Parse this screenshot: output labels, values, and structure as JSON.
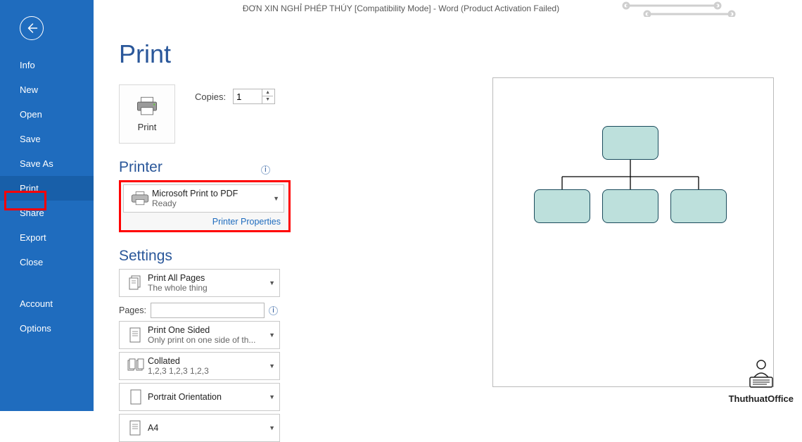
{
  "window_title": "ĐƠN XIN NGHỈ PHÉP THÚY [Compatibility Mode] - Word (Product Activation Failed)",
  "sidebar": {
    "items": [
      "Info",
      "New",
      "Open",
      "Save",
      "Save As",
      "Print",
      "Share",
      "Export",
      "Close"
    ],
    "bottom_items": [
      "Account",
      "Options"
    ],
    "selected": "Print"
  },
  "page": {
    "title": "Print",
    "print_button": "Print",
    "copies_label": "Copies:",
    "copies_value": "1"
  },
  "printer": {
    "heading": "Printer",
    "name": "Microsoft Print to PDF",
    "status": "Ready",
    "properties_link": "Printer Properties"
  },
  "settings": {
    "heading": "Settings",
    "pages_label": "Pages:",
    "pages_value": "",
    "options": [
      {
        "title": "Print All Pages",
        "sub": "The whole thing"
      },
      {
        "title": "Print One Sided",
        "sub": "Only print on one side of th..."
      },
      {
        "title": "Collated",
        "sub": "1,2,3   1,2,3   1,2,3"
      },
      {
        "title": "Portrait Orientation",
        "sub": ""
      },
      {
        "title": "A4",
        "sub": ""
      }
    ]
  },
  "watermark": "ThuthuatOffice"
}
